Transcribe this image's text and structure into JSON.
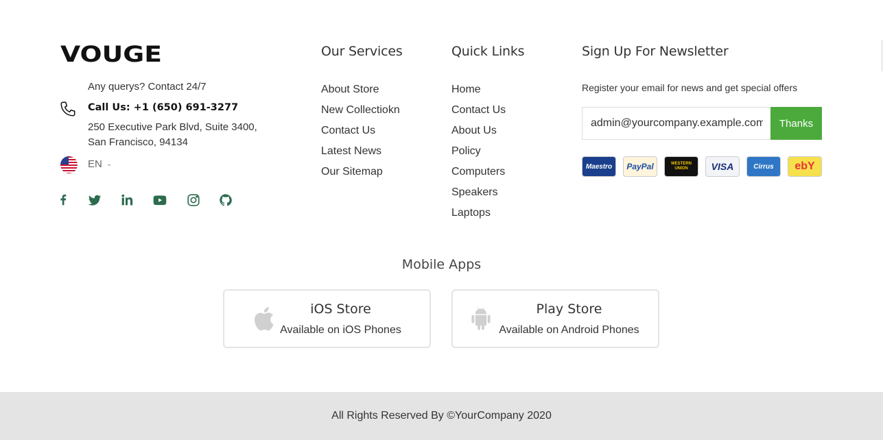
{
  "brand": {
    "logo_text": "VOUGE"
  },
  "contact": {
    "note": "Any querys? Contact 24/7",
    "call": "Call Us: +1 (650) 691-3277",
    "address_line1": "250 Executive Park Blvd, Suite 3400,",
    "address_line2": "San Francisco, 94134",
    "language": "EN"
  },
  "social": [
    "facebook-icon",
    "twitter-icon",
    "linkedin-icon",
    "youtube-icon",
    "instagram-icon",
    "github-icon"
  ],
  "services": {
    "title": "Our Services",
    "links": [
      "About Store",
      "New Collectiokn",
      "Contact Us",
      "Latest News",
      "Our Sitemap"
    ]
  },
  "quick_links": {
    "title": "Quick Links",
    "links": [
      "Home",
      "Contact Us",
      "About Us",
      "Policy",
      "Computers",
      "Speakers",
      "Laptops"
    ]
  },
  "newsletter": {
    "title": "Sign Up For Newsletter",
    "text": "Register your email for news and get special offers",
    "email_value": "admin@yourcompany.example.com",
    "button_label": "Thanks",
    "payments": [
      {
        "name": "Maestro",
        "bg": "#1a3f8c",
        "fg": "#ffffff"
      },
      {
        "name": "PayPal",
        "bg": "#fff4dc",
        "fg": "#1b4ea3"
      },
      {
        "name": "WESTERN UNION",
        "bg": "#111111",
        "fg": "#f5c400"
      },
      {
        "name": "VISA",
        "bg": "#f2f4f8",
        "fg": "#1a2d7a"
      },
      {
        "name": "Cirrus",
        "bg": "#2f77c6",
        "fg": "#ffffff"
      },
      {
        "name": "ebY",
        "bg": "#f6e04b",
        "fg": "#e53238"
      }
    ],
    "accent_color": "#4caa3d"
  },
  "mobile_apps": {
    "title": "Mobile Apps",
    "ios": {
      "name": "iOS Store",
      "subtitle": "Available on iOS Phones",
      "icon": "apple-icon"
    },
    "android": {
      "name": "Play Store",
      "subtitle": "Available on Android Phones",
      "icon": "android-icon"
    }
  },
  "footer": {
    "copyright": "All Rights Reserved By ©YourCompany 2020"
  }
}
